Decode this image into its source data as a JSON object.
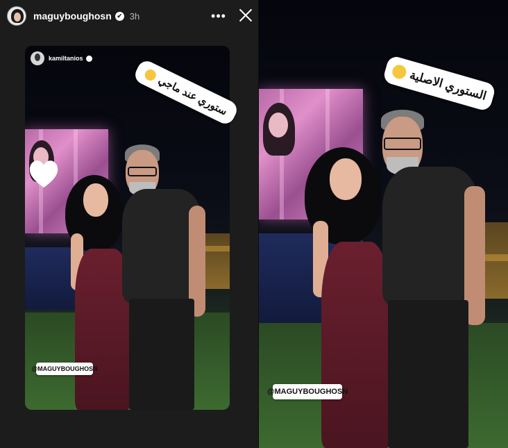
{
  "story": {
    "username": "maguyboughosn",
    "verified_mark": "✔",
    "time": "3h",
    "more_label": "•••",
    "close_icon": "close-icon"
  },
  "left_shared_post": {
    "source_username": "kamiltanios",
    "sticker_text": "ستوري عند ماجي",
    "sticker_emoji": "laughing-emoji",
    "mention_tag": "@MAGUYBOUGHOSN",
    "heart_sticker": "white-heart"
  },
  "right_story": {
    "sticker_text": "الستوري الاصلية",
    "sticker_emoji": "smiling-emoji",
    "mention_tag": "@MAGUYBOUGHOSN"
  },
  "colors": {
    "sticker_bg": "#ffffff",
    "emoji_yellow": "#f6c63f",
    "screen_pink": "#e08fc9",
    "dress": "#6a1f2e",
    "shirt": "#232323"
  }
}
